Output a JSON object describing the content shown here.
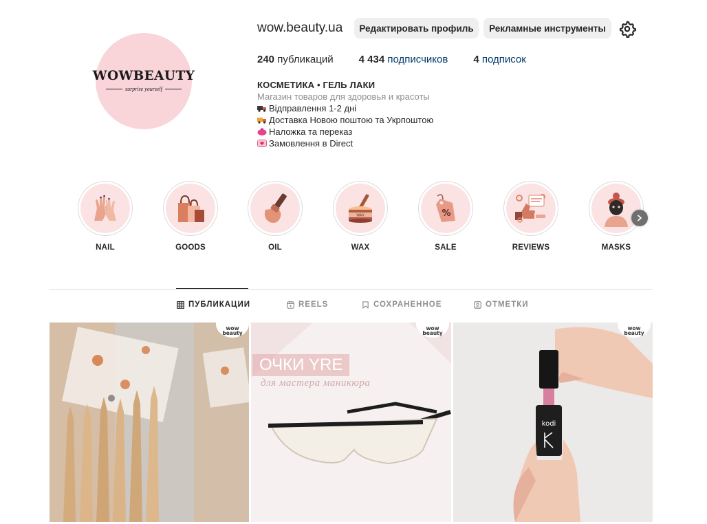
{
  "profile": {
    "username": "wow.beauty.ua",
    "avatar_logo": "WOWBEAUTY",
    "avatar_tagline": "surprise yourself",
    "edit_button": "Редактировать профиль",
    "ads_button": "Рекламные инструменты",
    "settings_icon": "gear-icon"
  },
  "stats": {
    "posts_count": "240",
    "posts_label": "публикаций",
    "followers_count": "4 434",
    "followers_label": "подписчиков",
    "following_count": "4",
    "following_label": "подписок"
  },
  "bio": {
    "name": "КОСМЕТИКА • ГЕЛЬ ЛАКИ",
    "category": "Магазин товаров для здоровья и красоты",
    "lines": [
      {
        "icon": "truck-icon",
        "text": "Відправлення 1-2 дні"
      },
      {
        "icon": "delivery-truck-icon",
        "text": "Доставка Новою поштою та Укрпоштою"
      },
      {
        "icon": "purse-icon",
        "text": "Наложка та переказ"
      },
      {
        "icon": "love-letter-icon",
        "text": "Замовлення в Direct"
      }
    ]
  },
  "highlights": [
    {
      "label": "NAIL",
      "icon": "hands-icon"
    },
    {
      "label": "GOODS",
      "icon": "shopping-bags-icon"
    },
    {
      "label": "OIL",
      "icon": "nail-polish-icon"
    },
    {
      "label": "WAX",
      "icon": "wax-jar-icon"
    },
    {
      "label": "SALE",
      "icon": "price-tag-icon"
    },
    {
      "label": "REVIEWS",
      "icon": "reviews-icon"
    },
    {
      "label": "MASKS",
      "icon": "face-mask-icon"
    }
  ],
  "tabs": [
    {
      "label": "ПУБЛИКАЦИИ",
      "icon": "grid-icon",
      "active": true
    },
    {
      "label": "REELS",
      "icon": "reels-icon",
      "active": false
    },
    {
      "label": "СОХРАНЕННОЕ",
      "icon": "bookmark-icon",
      "active": false
    },
    {
      "label": "ОТМЕТКИ",
      "icon": "tagged-icon",
      "active": false
    }
  ],
  "posts": [
    {
      "subject": "orange-wood-sticks",
      "badge_line1": "wow",
      "badge_line2": "beauty"
    },
    {
      "subject": "safety-glasses",
      "badge_line1": "wow",
      "badge_line2": "beauty",
      "title": "ОЧКИ YRE",
      "subtitle": "для мастера маникюра"
    },
    {
      "subject": "kodi-gel-polish-bottle",
      "badge_line1": "wow",
      "badge_line2": "beauty",
      "bottle_brand": "kodi"
    }
  ],
  "colors": {
    "link": "#00376b",
    "avatar_bg": "#f9d4d8",
    "highlight_bg": "#fbe3e4",
    "button_bg": "#efefef"
  }
}
